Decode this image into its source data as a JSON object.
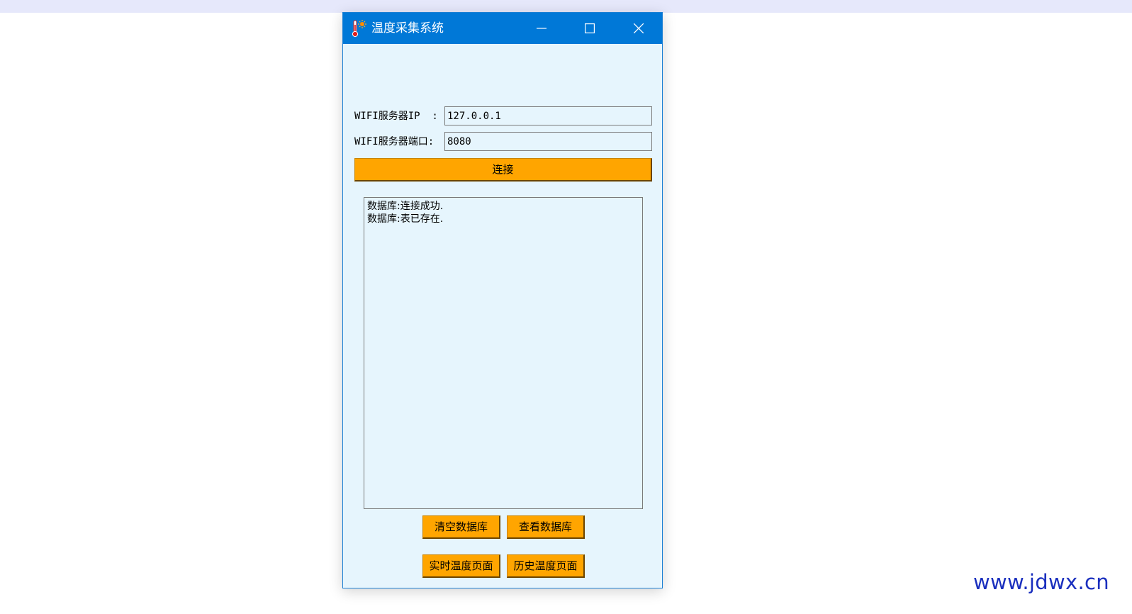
{
  "window": {
    "title": "温度采集系统",
    "icon": "thermometer-sun-icon",
    "controls": {
      "minimize_icon": "minimize-icon",
      "maximize_icon": "maximize-icon",
      "close_icon": "close-icon"
    },
    "titlebar_color": "#0078d7",
    "background_color": "#e6f5fd"
  },
  "form": {
    "ip_label": "WIFI服务器IP  :",
    "ip_value": "127.0.0.1",
    "port_label": "WIFI服务器端口:",
    "port_value": "8080",
    "connect_label": "连接"
  },
  "log": {
    "lines": [
      "数据库:连接成功.",
      "数据库:表已存在."
    ]
  },
  "actions": {
    "clear_db_label": "清空数据库",
    "view_db_label": "查看数据库",
    "realtime_label": "实时温度页面",
    "history_label": "历史温度页面",
    "button_color": "#ffa500"
  },
  "watermark": {
    "text": "www.jdwx.cn",
    "color": "#1a2fbe"
  }
}
